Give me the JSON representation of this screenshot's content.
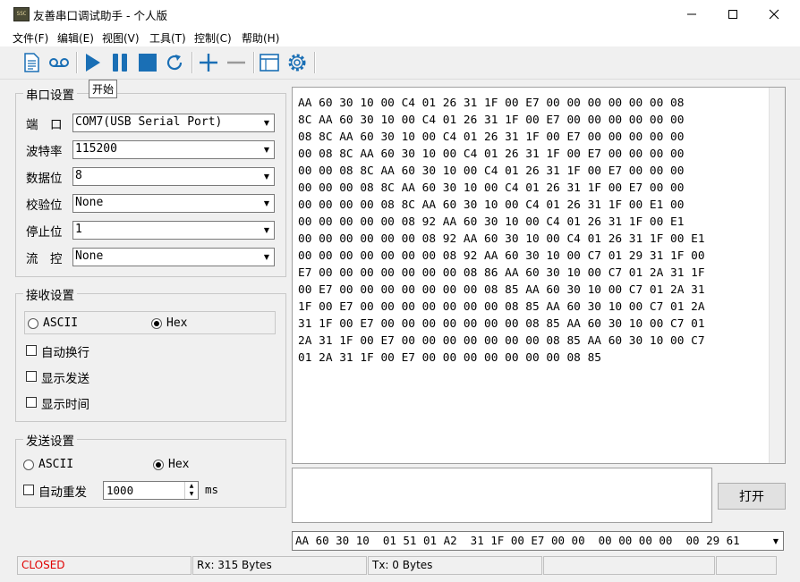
{
  "window": {
    "title": "友善串口调试助手 - 个人版",
    "icon_text": "SSC"
  },
  "menu": [
    "文件(F)",
    "编辑(E)",
    "视图(V)",
    "工具(T)",
    "控制(C)",
    "帮助(H)"
  ],
  "toolbar": {
    "icons": [
      "document-icon",
      "record-icon",
      "play-icon",
      "pause-icon",
      "stop-icon",
      "refresh-icon",
      "plus-icon",
      "minus-icon",
      "window-icon",
      "gear-icon"
    ],
    "tooltip": "开始"
  },
  "serial_settings": {
    "title": "串口设置",
    "port_label": "端　口",
    "port_value": "COM7(USB Serial Port)",
    "baud_label": "波特率",
    "baud_value": "115200",
    "databits_label": "数据位",
    "databits_value": "8",
    "parity_label": "校验位",
    "parity_value": "None",
    "stopbits_label": "停止位",
    "stopbits_value": "1",
    "flow_label": "流　控",
    "flow_value": "None"
  },
  "receive_settings": {
    "title": "接收设置",
    "ascii_label": "ASCII",
    "hex_label": "Hex",
    "selected": "Hex",
    "auto_newline": "自动换行",
    "show_send": "显示发送",
    "show_time": "显示时间"
  },
  "send_settings": {
    "title": "发送设置",
    "ascii_label": "ASCII",
    "hex_label": "Hex",
    "selected": "Hex",
    "auto_resend": "自动重发",
    "interval": "1000",
    "unit": "ms"
  },
  "receive_lines": [
    "AA 60 30 10 00 C4 01 26 31 1F 00 E7 00 00 00 00 00 00 08",
    "8C AA 60 30 10 00 C4 01 26 31 1F 00 E7 00 00 00 00 00 00",
    "08 8C AA 60 30 10 00 C4 01 26 31 1F 00 E7 00 00 00 00 00",
    "00 08 8C AA 60 30 10 00 C4 01 26 31 1F 00 E7 00 00 00 00",
    "00 00 08 8C AA 60 30 10 00 C4 01 26 31 1F 00 E7 00 00 00",
    "00 00 00 08 8C AA 60 30 10 00 C4 01 26 31 1F 00 E7 00 00",
    "00 00 00 00 08 8C AA 60 30 10 00 C4 01 26 31 1F 00 E1 00",
    "00 00 00 00 00 08 92 AA 60 30 10 00 C4 01 26 31 1F 00 E1",
    "00 00 00 00 00 00 08 92 AA 60 30 10 00 C4 01 26 31 1F 00 E1",
    "00 00 00 00 00 00 00 08 92 AA 60 30 10 00 C7 01 29 31 1F 00",
    "E7 00 00 00 00 00 00 00 08 86 AA 60 30 10 00 C7 01 2A 31 1F",
    "00 E7 00 00 00 00 00 00 00 08 85 AA 60 30 10 00 C7 01 2A 31",
    "1F 00 E7 00 00 00 00 00 00 00 08 85 AA 60 30 10 00 C7 01 2A",
    "31 1F 00 E7 00 00 00 00 00 00 00 08 85 AA 60 30 10 00 C7 01",
    "2A 31 1F 00 E7 00 00 00 00 00 00 00 08 85 AA 60 30 10 00 C7",
    "01 2A 31 1F 00 E7 00 00 00 00 00 00 00 08 85"
  ],
  "send_area": {
    "value": ""
  },
  "open_button": "打开",
  "history_value": "AA 60 30 10  01 51 01 A2  31 1F 00 E7 00 00  00 00 00 00  00 29 61",
  "status": {
    "state": "CLOSED",
    "state_color": "#e00000",
    "rx": "Rx: 315 Bytes",
    "tx": "Tx: 0 Bytes"
  }
}
